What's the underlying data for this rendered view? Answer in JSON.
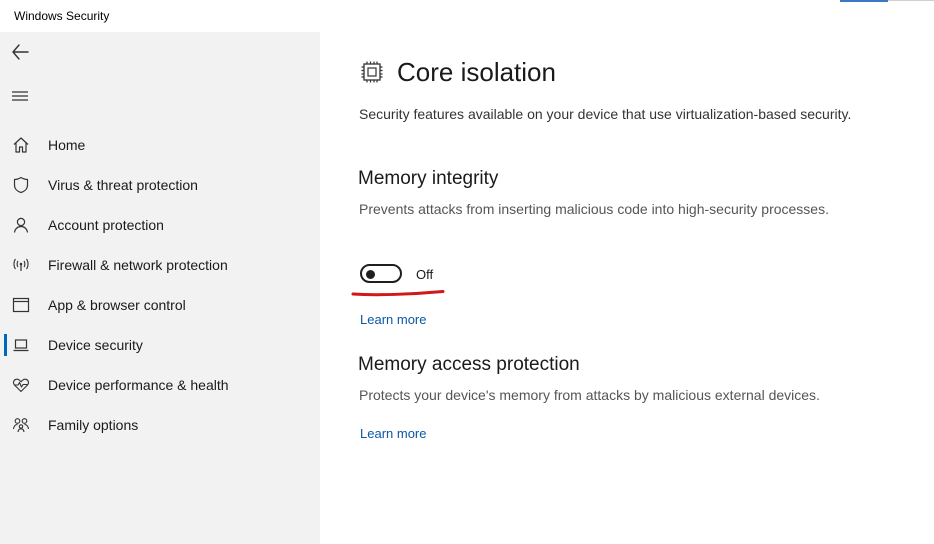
{
  "window": {
    "title": "Windows Security"
  },
  "sidebar": {
    "back_icon": "back-arrow-icon",
    "menu_icon": "hamburger-menu-icon",
    "items": [
      {
        "label": "Home",
        "icon": "home-icon",
        "active": false
      },
      {
        "label": "Virus & threat protection",
        "icon": "shield-icon",
        "active": false
      },
      {
        "label": "Account protection",
        "icon": "person-icon",
        "active": false
      },
      {
        "label": "Firewall & network protection",
        "icon": "antenna-icon",
        "active": false
      },
      {
        "label": "App & browser control",
        "icon": "browser-window-icon",
        "active": false
      },
      {
        "label": "Device security",
        "icon": "laptop-icon",
        "active": true
      },
      {
        "label": "Device performance & health",
        "icon": "heart-pulse-icon",
        "active": false
      },
      {
        "label": "Family options",
        "icon": "family-icon",
        "active": false
      }
    ]
  },
  "main": {
    "icon": "chip-icon",
    "title": "Core isolation",
    "description": "Security features available on your device that use virtualization-based security.",
    "memory_integrity": {
      "title": "Memory integrity",
      "description": "Prevents attacks from inserting malicious code into high-security processes.",
      "toggle_on": false,
      "toggle_state": "Off",
      "learn_more": "Learn more"
    },
    "memory_access": {
      "title": "Memory access protection",
      "description": "Protects your device's memory from attacks by malicious external devices.",
      "learn_more": "Learn more"
    }
  },
  "colors": {
    "sidebar_bg": "#f2f2f2",
    "accent": "#0067c0",
    "link": "#0a58a6",
    "annotation_red": "#d01818"
  }
}
